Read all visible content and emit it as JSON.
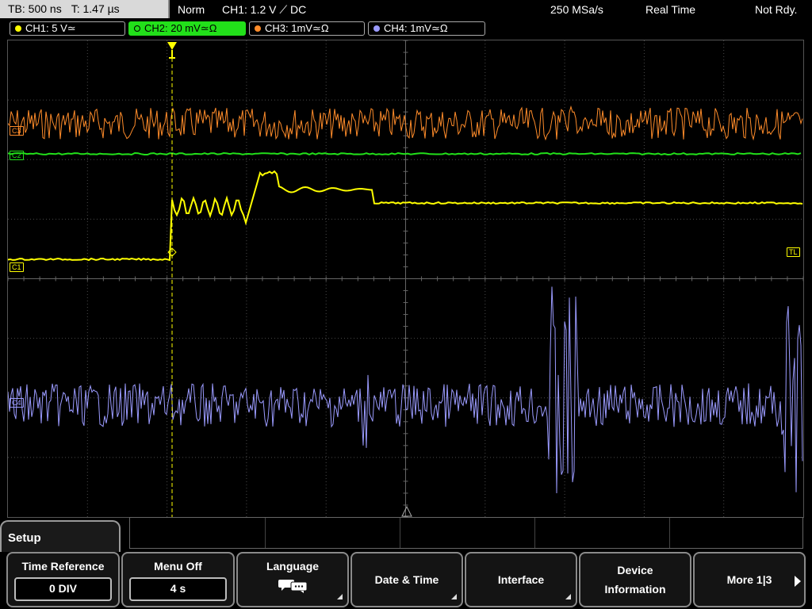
{
  "top": {
    "tb_label": "TB: 500 ns",
    "trigger_time": "T: 1.47 µs",
    "mode": "Norm",
    "trigger_info": "CH1: 1.2 V ⟋ DC",
    "sample_rate": "250 MSa/s",
    "acq_mode": "Real Time",
    "status": "Not Rdy."
  },
  "channels": [
    {
      "label": "CH1: 5 V≃",
      "color": "#ffff00",
      "active": false
    },
    {
      "label": "CH2: 20 mV≃Ω",
      "color": "#22e01a",
      "active": true
    },
    {
      "label": "CH3: 1mV≃Ω",
      "color": "#ff8c2a",
      "active": false
    },
    {
      "label": "CH4: 1mV≃Ω",
      "color": "#9b9bff",
      "active": false
    }
  ],
  "markers": {
    "c3": "C3",
    "c2": "C2",
    "c1": "C1",
    "c4": "C4",
    "trigger_level": "TL",
    "trigger_pos": "T"
  },
  "menu": {
    "title": "Setup",
    "softkeys": [
      {
        "label": "Time Reference",
        "value": "0 DIV"
      },
      {
        "label": "Menu Off",
        "value": "4 s"
      },
      {
        "label": "Language",
        "icon": "speech-bubbles-icon"
      },
      {
        "label": "Date & Time"
      },
      {
        "label": "Interface"
      },
      {
        "label_line1": "Device",
        "label_line2": "Information"
      },
      {
        "label": "More 1|3"
      }
    ]
  },
  "colors": {
    "ch1": "#ffff00",
    "ch2": "#22e01a",
    "ch3": "#ff8c2a",
    "ch4": "#9b9bff",
    "grid": "#4a4a4a"
  }
}
